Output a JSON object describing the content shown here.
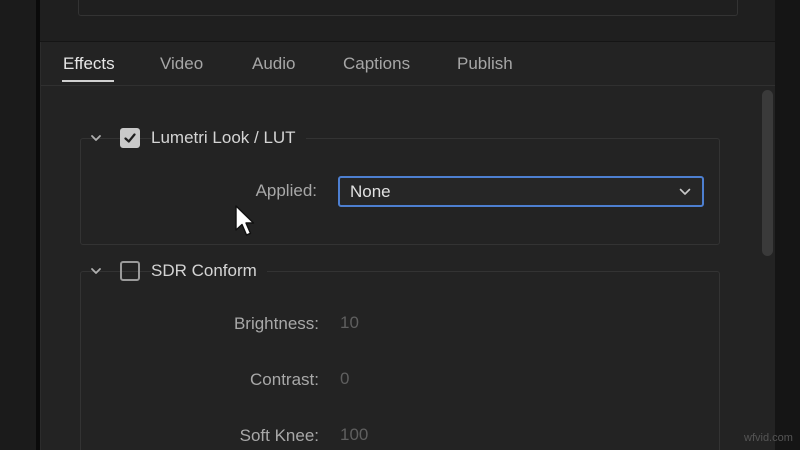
{
  "tabs": [
    {
      "label": "Effects",
      "active": true
    },
    {
      "label": "Video",
      "active": false
    },
    {
      "label": "Audio",
      "active": false
    },
    {
      "label": "Captions",
      "active": false
    },
    {
      "label": "Publish",
      "active": false
    }
  ],
  "lumetri": {
    "title": "Lumetri Look / LUT",
    "enabled": true,
    "applied_label": "Applied:",
    "applied_value": "None"
  },
  "sdr": {
    "title": "SDR Conform",
    "enabled": false,
    "fields": [
      {
        "label": "Brightness:",
        "value": "10"
      },
      {
        "label": "Contrast:",
        "value": "0"
      },
      {
        "label": "Soft Knee:",
        "value": "100"
      }
    ]
  },
  "icons": {
    "chevron": "chevron-down-icon",
    "checkbox": "checkbox-icon",
    "dropdown": "dropdown-arrow-icon",
    "cursor": "mouse-pointer-icon"
  },
  "colors": {
    "accent": "#4d7fd0",
    "panel": "#232323",
    "text": "#d4d4d4"
  },
  "watermark": "wfvid.com"
}
